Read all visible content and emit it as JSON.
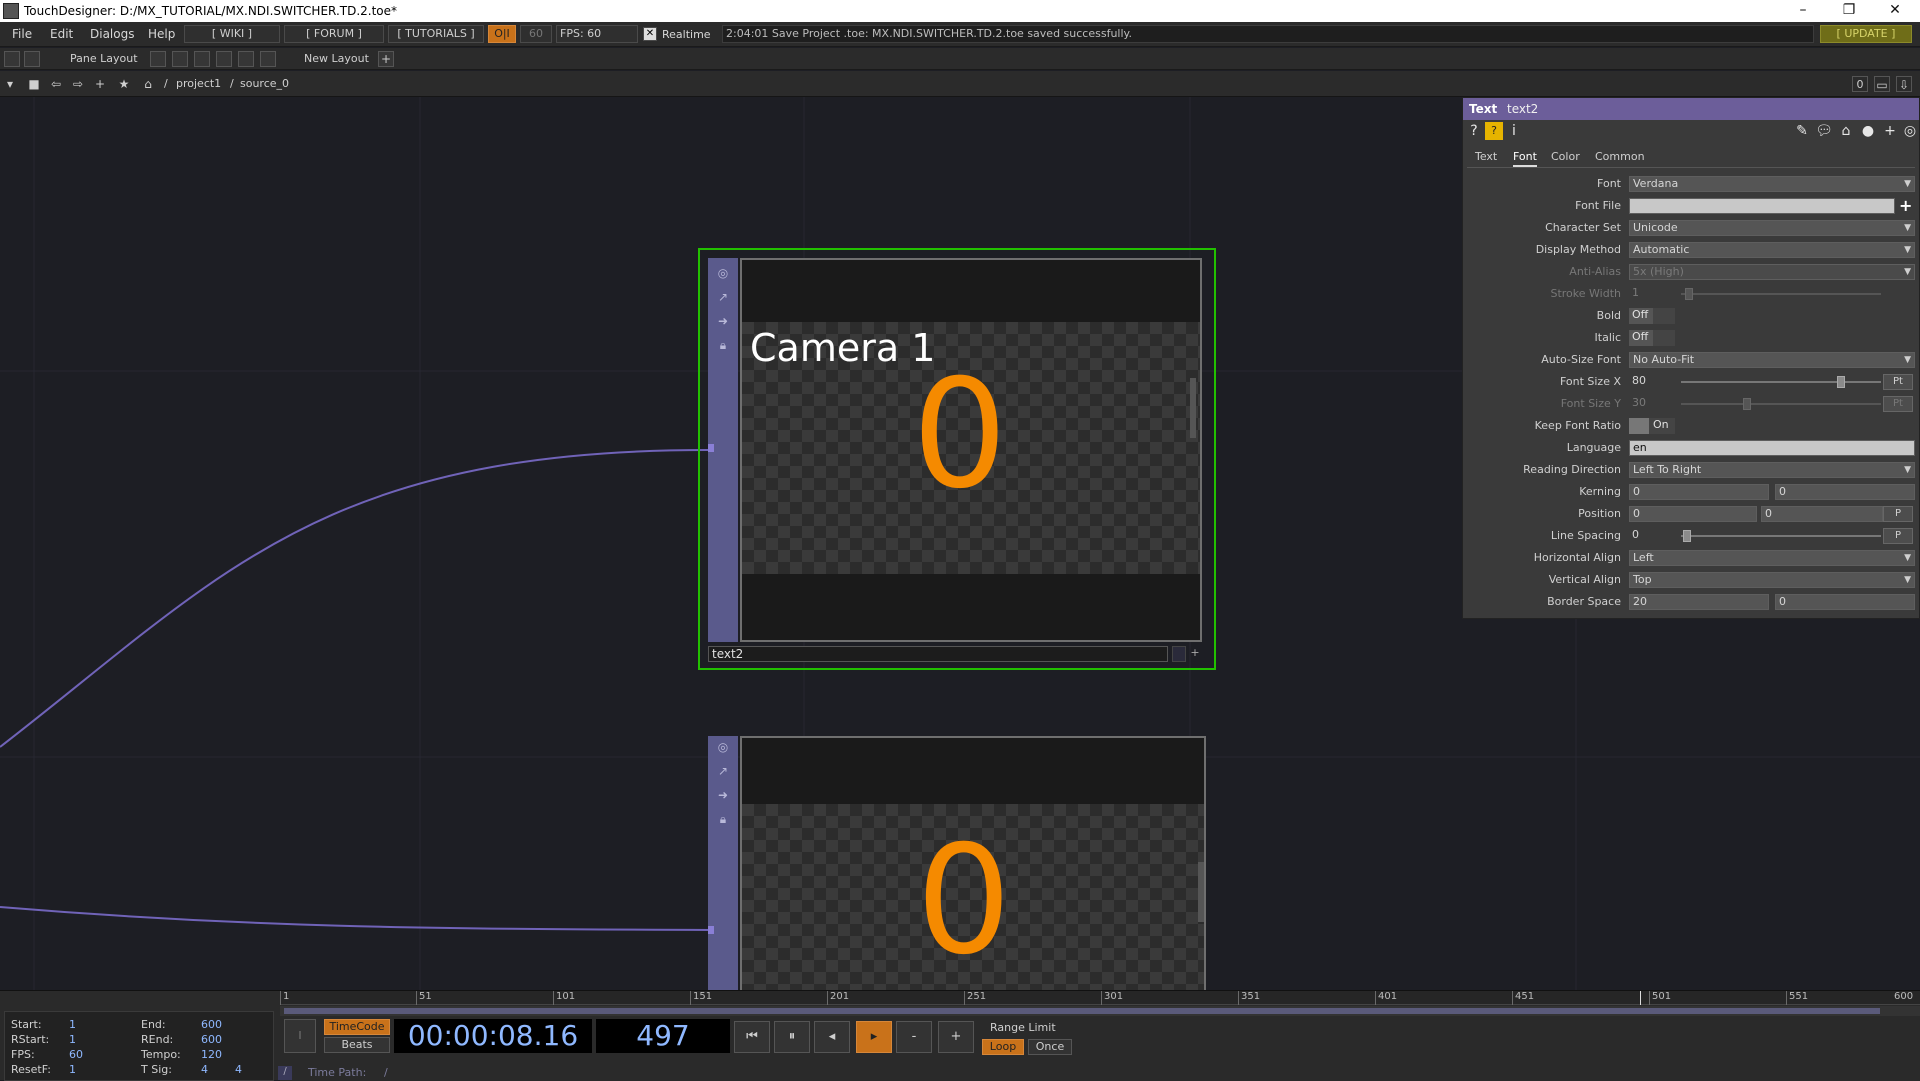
{
  "window": {
    "title": "TouchDesigner: D:/MX_TUTORIAL/MX.NDI.SWITCHER.TD.2.toe*",
    "minimize": "–",
    "maximize": "❐",
    "close": "✕"
  },
  "menu": {
    "items": [
      "File",
      "Edit",
      "Dialogs",
      "Help"
    ],
    "wiki": "[ WIKI ]",
    "forum": "[ FORUM ]",
    "tutorials": "[ TUTORIALS ]",
    "oi": "O|I",
    "fps_target": "60",
    "fps_label": "FPS:  60",
    "realtime": "Realtime",
    "status_message": "2:04:01 Save Project .toe: MX.NDI.SWITCHER.TD.2.toe saved successfully.",
    "update": "[ UPDATE ]"
  },
  "pane": {
    "pane_layout": "Pane Layout",
    "new_layout": "New Layout",
    "add": "+"
  },
  "path": {
    "root": "/",
    "project": "project1",
    "sep": "/",
    "current": "source_0",
    "right_zero": "0"
  },
  "nodes": [
    {
      "name": "text2",
      "label": "Camera 1",
      "number": "0"
    },
    {
      "name": "",
      "label": "",
      "number": "0"
    }
  ],
  "params": {
    "op_type": "Text",
    "op_name": "text2",
    "tabs": [
      "Text",
      "Font",
      "Color",
      "Common"
    ],
    "active_tab": "Font",
    "rows": {
      "font": {
        "label": "Font",
        "value": "Verdana"
      },
      "font_file": {
        "label": "Font File",
        "value": ""
      },
      "char_set": {
        "label": "Character Set",
        "value": "Unicode"
      },
      "display_method": {
        "label": "Display Method",
        "value": "Automatic"
      },
      "anti_alias": {
        "label": "Anti-Alias",
        "value": "5x (High)"
      },
      "stroke_width": {
        "label": "Stroke Width",
        "value": "1"
      },
      "bold": {
        "label": "Bold",
        "value": "Off"
      },
      "italic": {
        "label": "Italic",
        "value": "Off"
      },
      "auto_size": {
        "label": "Auto-Size Font",
        "value": "No Auto-Fit"
      },
      "font_size_x": {
        "label": "Font Size X",
        "value": "80",
        "unit": "Pt"
      },
      "font_size_y": {
        "label": "Font Size Y",
        "value": "30",
        "unit": "Pt"
      },
      "keep_ratio": {
        "label": "Keep Font Ratio",
        "value": "On"
      },
      "language": {
        "label": "Language",
        "value": "en"
      },
      "reading_dir": {
        "label": "Reading Direction",
        "value": "Left To Right"
      },
      "kerning": {
        "label": "Kerning",
        "value1": "0",
        "value2": "0"
      },
      "position": {
        "label": "Position",
        "value1": "0",
        "value2": "0",
        "unit": "P"
      },
      "line_spacing": {
        "label": "Line Spacing",
        "value": "0",
        "unit": "P"
      },
      "h_align": {
        "label": "Horizontal Align",
        "value": "Left"
      },
      "v_align": {
        "label": "Vertical Align",
        "value": "Top"
      },
      "border_space": {
        "label": "Border Space",
        "value1": "20",
        "value2": "0"
      }
    }
  },
  "timeline": {
    "ticks": [
      "1",
      "51",
      "101",
      "151",
      "201",
      "251",
      "301",
      "351",
      "401",
      "451",
      "501",
      "551",
      "600"
    ],
    "stats": {
      "start_label": "Start:",
      "start": "1",
      "end_label": "End:",
      "end": "600",
      "rstart_label": "RStart:",
      "rstart": "1",
      "rend_label": "REnd:",
      "rend": "600",
      "fps_label": "FPS:",
      "fps": "60",
      "tempo_label": "Tempo:",
      "tempo": "120",
      "resetf_label": "ResetF:",
      "resetf": "1",
      "tsig_label": "T Sig:",
      "tsig1": "4",
      "tsig2": "4"
    },
    "timecode_btn": "TimeCode",
    "beats_btn": "Beats",
    "timecode": "00:00:08.16",
    "frame": "497",
    "range_limit": "Range Limit",
    "loop": "Loop",
    "once": "Once",
    "minus": "-",
    "plus": "+",
    "time_path_label": "Time Path:",
    "time_path": "/",
    "i": "I"
  }
}
